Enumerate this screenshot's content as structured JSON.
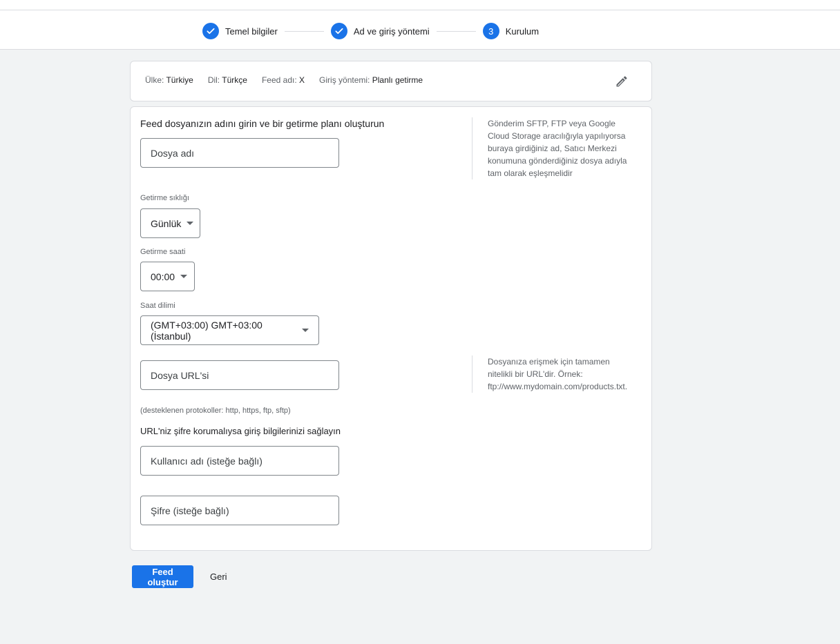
{
  "stepper": {
    "steps": [
      {
        "label": "Temel bilgiler",
        "state": "done",
        "icon": "check-icon"
      },
      {
        "label": "Ad ve giriş yöntemi",
        "state": "done",
        "icon": "check-icon"
      },
      {
        "label": "Kurulum",
        "state": "active",
        "number": "3"
      }
    ]
  },
  "summary": {
    "country_key": "Ülke:",
    "country_val": "Türkiye",
    "language_key": "Dil:",
    "language_val": "Türkçe",
    "feed_key": "Feed adı:",
    "feed_val": "X",
    "method_key": "Giriş yöntemi:",
    "method_val": "Planlı getirme",
    "edit_icon": "pencil-icon"
  },
  "form": {
    "title": "Feed dosyanızın adını girin ve bir getirme planı oluşturun",
    "file_name_placeholder": "Dosya adı",
    "file_name_help": "Gönderim SFTP, FTP veya Google Cloud Storage aracılığıyla yapılıyorsa buraya girdiğiniz ad, Satıcı Merkezi konumuna gönderdiğiniz dosya adıyla tam olarak eşleşmelidir",
    "frequency_label": "Getirme sıklığı",
    "frequency_value": "Günlük",
    "time_label": "Getirme saati",
    "time_value": "00:00",
    "timezone_label": "Saat dilimi",
    "timezone_value": "(GMT+03:00) GMT+03:00 (İstanbul)",
    "url_placeholder": "Dosya URL'si",
    "url_help": "Dosyanıza erişmek için tamamen nitelikli bir URL'dir. Örnek: ftp://www.mydomain.com/products.txt.",
    "protocols_note": "(desteklenen protokoller: http, https, ftp, sftp)",
    "credentials_title": "URL'niz şifre korumalıysa giriş bilgilerinizi sağlayın",
    "username_placeholder": "Kullanıcı adı (isteğe bağlı)",
    "password_placeholder": "Şifre (isteğe bağlı)"
  },
  "actions": {
    "create_label": "Feed oluştur",
    "back_label": "Geri"
  },
  "colors": {
    "accent": "#1a73e8",
    "background": "#f1f3f4",
    "border": "#dadce0"
  }
}
